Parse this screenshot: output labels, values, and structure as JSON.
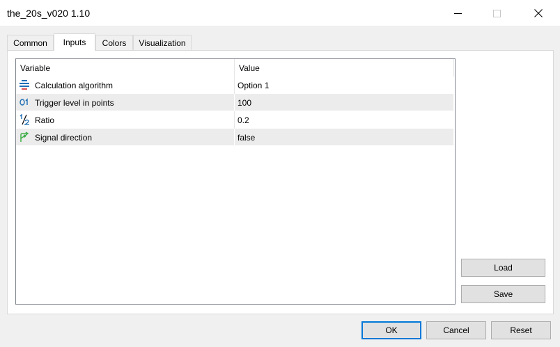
{
  "window": {
    "title": "the_20s_v020 1.10"
  },
  "tabs": [
    {
      "label": "Common",
      "active": false
    },
    {
      "label": "Inputs",
      "active": true
    },
    {
      "label": "Colors",
      "active": false
    },
    {
      "label": "Visualization",
      "active": false
    }
  ],
  "grid": {
    "headers": {
      "variable": "Variable",
      "value": "Value"
    },
    "rows": [
      {
        "icon": "list-enum-icon",
        "name": "Calculation algorithm",
        "value": "Option 1"
      },
      {
        "icon": "integer-icon",
        "name": "Trigger level in points",
        "value": "100"
      },
      {
        "icon": "fraction-icon",
        "name": "Ratio",
        "value": "0.2"
      },
      {
        "icon": "boolean-arrow-icon",
        "name": "Signal direction",
        "value": "false"
      }
    ]
  },
  "side_buttons": {
    "load": "Load",
    "save": "Save"
  },
  "footer_buttons": {
    "ok": "OK",
    "cancel": "Cancel",
    "reset": "Reset"
  },
  "colors": {
    "accent": "#0078d7",
    "row_alt": "#ececec",
    "icon_blue": "#1f6fb5",
    "icon_red": "#d9534f",
    "icon_green": "#3fae49"
  }
}
